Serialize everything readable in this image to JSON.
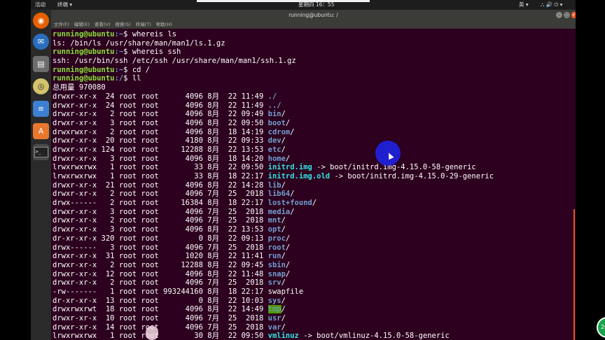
{
  "topbar": {
    "activities": "活动",
    "app_menu": "终端 ▾",
    "clock": "星期四 16：55",
    "ime": "英 ▾",
    "status_icons": "⛬ 🔊 ⏻ ▾"
  },
  "window": {
    "title": "running@ubuntu: /",
    "menu": [
      "文件(F)",
      "编辑(E)",
      "查看(V)",
      "搜索(S)",
      "终端(T)",
      "帮助(H)"
    ]
  },
  "dock": [
    "firefox-icon",
    "thunderbird-icon",
    "files-icon",
    "rhythmbox-icon",
    "writer-icon",
    "software-center-icon",
    "terminal-icon"
  ],
  "prompt": {
    "user": "running@ubuntu",
    "path": ":~",
    "sign": "$ "
  },
  "terminal_lines": [
    {
      "kind": "cmd",
      "user": "running@ubuntu",
      "path": ":~",
      "sign": "$ ",
      "text": "whereis ls"
    },
    {
      "kind": "out",
      "text": "ls: /bin/ls /usr/share/man/man1/ls.1.gz"
    },
    {
      "kind": "cmd",
      "user": "running@ubuntu",
      "path": ":~",
      "sign": "$ ",
      "text": "whereis ssh"
    },
    {
      "kind": "out",
      "text": "ssh: /usr/bin/ssh /etc/ssh /usr/share/man/man1/ssh.1.gz"
    },
    {
      "kind": "cmd",
      "user": "running@ubuntu",
      "path": ":~",
      "sign": "$ ",
      "text": "cd /"
    },
    {
      "kind": "cmd",
      "user": "running@ubuntu",
      "path": ":/",
      "sign": "$ ",
      "text": "ll"
    },
    {
      "kind": "out",
      "text": "总用量 970080"
    },
    {
      "kind": "ls",
      "meta": "drwxr-xr-x  24 root root      4096 8月  22 11:49 ",
      "name": "./",
      "cls": "dir"
    },
    {
      "kind": "ls",
      "meta": "drwxr-xr-x  24 root root      4096 8月  22 11:49 ",
      "name": "../",
      "cls": "dir"
    },
    {
      "kind": "ls",
      "meta": "drwxr-xr-x   2 root root      4096 8月  22 09:49 ",
      "name": "bin",
      "cls": "dir",
      "suffix": "/"
    },
    {
      "kind": "ls",
      "meta": "drwxr-xr-x   3 root root      4096 8月  22 09:50 ",
      "name": "boot",
      "cls": "dir",
      "suffix": "/"
    },
    {
      "kind": "ls",
      "meta": "drwxrwxr-x   2 root root      4096 8月  18 14:19 ",
      "name": "cdrom",
      "cls": "dir",
      "suffix": "/"
    },
    {
      "kind": "ls",
      "meta": "drwxr-xr-x  20 root root      4180 8月  22 09:33 ",
      "name": "dev",
      "cls": "dir",
      "suffix": "/"
    },
    {
      "kind": "ls",
      "meta": "drwxr-xr-x 124 root root     12288 8月  22 13:53 ",
      "name": "etc",
      "cls": "dir",
      "suffix": "/"
    },
    {
      "kind": "ls",
      "meta": "drwxr-xr-x   3 root root      4096 8月  18 14:20 ",
      "name": "home",
      "cls": "dir",
      "suffix": "/"
    },
    {
      "kind": "ls",
      "meta": "lrwxrwxrwx   1 root root        33 8月  22 09:50 ",
      "name": "initrd.img",
      "cls": "lnk",
      "suffix": " -> boot/initrd.img-4.15.0-58-generic"
    },
    {
      "kind": "ls",
      "meta": "lrwxrwxrwx   1 root root        33 8月  18 22:17 ",
      "name": "initrd.img.old",
      "cls": "lnk",
      "suffix": " -> boot/initrd.img-4.15.0-29-generic"
    },
    {
      "kind": "ls",
      "meta": "drwxr-xr-x  21 root root      4096 8月  22 14:28 ",
      "name": "lib",
      "cls": "dir",
      "suffix": "/"
    },
    {
      "kind": "ls",
      "meta": "drwxr-xr-x   2 root root      4096 7月  25  2018 ",
      "name": "lib64",
      "cls": "dir",
      "suffix": "/"
    },
    {
      "kind": "ls",
      "meta": "drwx------   2 root root     16384 8月  18 22:17 ",
      "name": "lost+found",
      "cls": "dir",
      "suffix": "/"
    },
    {
      "kind": "ls",
      "meta": "drwxr-xr-x   3 root root      4096 7月  25  2018 ",
      "name": "media",
      "cls": "dir",
      "suffix": "/"
    },
    {
      "kind": "ls",
      "meta": "drwxr-xr-x   2 root root      4096 7月  25  2018 ",
      "name": "mnt",
      "cls": "dir",
      "suffix": "/"
    },
    {
      "kind": "ls",
      "meta": "drwxr-xr-x   3 root root      4096 8月  22 13:53 ",
      "name": "opt",
      "cls": "dir",
      "suffix": "/"
    },
    {
      "kind": "ls",
      "meta": "dr-xr-xr-x 320 root root         0 8月  22 09:13 ",
      "name": "proc",
      "cls": "dir",
      "suffix": "/"
    },
    {
      "kind": "ls",
      "meta": "drwx------   3 root root      4096 7月  25  2018 ",
      "name": "root",
      "cls": "dir",
      "suffix": "/"
    },
    {
      "kind": "ls",
      "meta": "drwxr-xr-x  31 root root      1020 8月  22 11:41 ",
      "name": "run",
      "cls": "dir",
      "suffix": "/"
    },
    {
      "kind": "ls",
      "meta": "drwxr-xr-x   2 root root     12288 8月  22 09:45 ",
      "name": "sbin",
      "cls": "dir",
      "suffix": "/"
    },
    {
      "kind": "ls",
      "meta": "drwxr-xr-x  12 root root      4096 8月  22 11:48 ",
      "name": "snap",
      "cls": "dir",
      "suffix": "/"
    },
    {
      "kind": "ls",
      "meta": "drwxr-xr-x   2 root root      4096 7月  25  2018 ",
      "name": "srv",
      "cls": "dir",
      "suffix": "/"
    },
    {
      "kind": "ls",
      "meta": "-rw-------   1 root root 993244160 8月  18 22:17 ",
      "name": "swapfile",
      "cls": "plain"
    },
    {
      "kind": "ls",
      "meta": "dr-xr-xr-x  13 root root         0 8月  22 10:03 ",
      "name": "sys",
      "cls": "dir",
      "suffix": "/"
    },
    {
      "kind": "ls",
      "meta": "drwxrwxrwt  18 root root      4096 8月  22 14:49 ",
      "name": "tmp",
      "cls": "sticky",
      "suffix": "/"
    },
    {
      "kind": "ls",
      "meta": "drwxr-xr-x  10 root root      4096 7月  25  2018 ",
      "name": "usr",
      "cls": "dir",
      "suffix": "/"
    },
    {
      "kind": "ls",
      "meta": "drwxr-xr-x  14 root root      4096 7月  25  2018 ",
      "name": "var",
      "cls": "dir",
      "suffix": "/"
    },
    {
      "kind": "ls",
      "meta": "lrwxrwxrwx   1 root root        30 8月  22 09:50 ",
      "name": "vmlinuz",
      "cls": "lnk",
      "suffix": " -> boot/vmlinuz-4.15.0-58-generic"
    }
  ],
  "badge": "20",
  "colors": {
    "terminal_bg": "#2c001e",
    "prompt_user": "#8ae234",
    "prompt_path": "#729fcf",
    "dir": "#729fcf",
    "link": "#34e2e2",
    "accent": "#e95420"
  }
}
